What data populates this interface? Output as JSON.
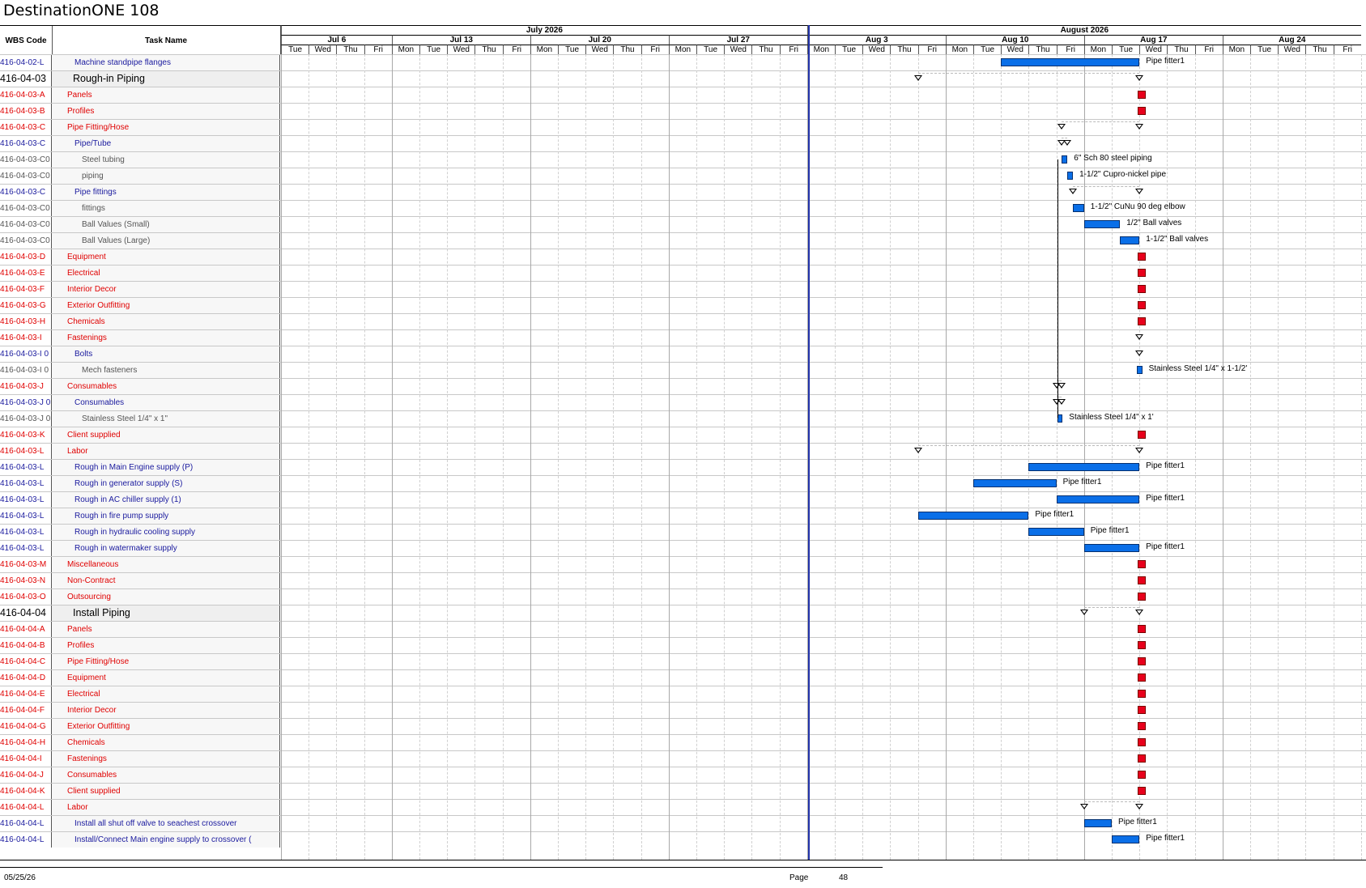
{
  "title": "DestinationONE 108",
  "columns": {
    "wbs": "WBS Code",
    "task": "Task Name"
  },
  "months": [
    "July 2026",
    "August 2026"
  ],
  "weeks": [
    "Jul 6",
    "Jul 13",
    "Jul 20",
    "Jul 27",
    "Aug 3",
    "Aug 10",
    "Aug 17",
    "Aug 24"
  ],
  "days": [
    "Tue",
    "Wed",
    "Thu",
    "Fri",
    "Mon",
    "Tue",
    "Wed",
    "Thu",
    "Fri",
    "Mon",
    "Tue",
    "Wed",
    "Thu",
    "Fri",
    "Mon",
    "Tue",
    "Wed",
    "Thu",
    "Fri",
    "Mon",
    "Tue",
    "Wed",
    "Thu",
    "Fri",
    "Mon",
    "Tue",
    "Wed",
    "Thu",
    "Fri",
    "Mon",
    "Tue",
    "Wed",
    "Thu",
    "Fri",
    "Mon",
    "Tue",
    "Wed",
    "Thu",
    "Fri"
  ],
  "rows": [
    {
      "wbs": "416-04-02-L",
      "task": "Machine standpipe flanges",
      "style": "blue",
      "indent": 2,
      "kind": "bar",
      "start": 26,
      "end": 31,
      "label": "Pipe fitter1"
    },
    {
      "wbs": "416-04-03",
      "task": "Rough-in Piping",
      "style": "big",
      "indent": 1,
      "kind": "summary",
      "start": 23,
      "end": 31
    },
    {
      "wbs": "416-04-03-A",
      "task": "Panels",
      "style": "red",
      "indent": 1,
      "kind": "mile",
      "start": 31
    },
    {
      "wbs": "416-04-03-B",
      "task": "Profiles",
      "style": "red",
      "indent": 1,
      "kind": "mile",
      "start": 31
    },
    {
      "wbs": "416-04-03-C",
      "task": "Pipe Fitting/Hose",
      "style": "red",
      "indent": 1,
      "kind": "summary",
      "start": 28.2,
      "end": 31
    },
    {
      "wbs": "416-04-03-C",
      "task": "Pipe/Tube",
      "style": "blue",
      "indent": 2,
      "kind": "summary",
      "start": 28.2,
      "end": 28.4
    },
    {
      "wbs": "416-04-03-C0",
      "task": "Steel tubing",
      "style": "gray",
      "indent": 3,
      "kind": "bar",
      "start": 28.2,
      "end": 28.4,
      "label": "6\" Sch 80 steel piping"
    },
    {
      "wbs": "416-04-03-C0",
      "task": "piping",
      "style": "gray",
      "indent": 3,
      "kind": "bar",
      "start": 28.4,
      "end": 28.6,
      "label": "1-1/2\" Cupro-nickel pipe"
    },
    {
      "wbs": "416-04-03-C",
      "task": "Pipe fittings",
      "style": "blue",
      "indent": 2,
      "kind": "summary",
      "start": 28.6,
      "end": 31
    },
    {
      "wbs": "416-04-03-C0",
      "task": "fittings",
      "style": "gray",
      "indent": 3,
      "kind": "bar",
      "start": 28.6,
      "end": 29,
      "label": "1-1/2\" CuNu 90 deg elbow"
    },
    {
      "wbs": "416-04-03-C0",
      "task": "Ball Values (Small)",
      "style": "gray",
      "indent": 3,
      "kind": "bar",
      "start": 29,
      "end": 30.3,
      "label": "1/2\" Ball valves"
    },
    {
      "wbs": "416-04-03-C0",
      "task": "Ball Values (Large)",
      "style": "gray",
      "indent": 3,
      "kind": "bar",
      "start": 30.3,
      "end": 31,
      "label": "1-1/2\" Ball valves"
    },
    {
      "wbs": "416-04-03-D",
      "task": "Equipment",
      "style": "red",
      "indent": 1,
      "kind": "mile",
      "start": 31
    },
    {
      "wbs": "416-04-03-E",
      "task": "Electrical",
      "style": "red",
      "indent": 1,
      "kind": "mile",
      "start": 31
    },
    {
      "wbs": "416-04-03-F",
      "task": "Interior Decor",
      "style": "red",
      "indent": 1,
      "kind": "mile",
      "start": 31
    },
    {
      "wbs": "416-04-03-G",
      "task": "Exterior Outfitting",
      "style": "red",
      "indent": 1,
      "kind": "mile",
      "start": 31
    },
    {
      "wbs": "416-04-03-H",
      "task": "Chemicals",
      "style": "red",
      "indent": 1,
      "kind": "mile",
      "start": 31
    },
    {
      "wbs": "416-04-03-I",
      "task": "Fastenings",
      "style": "red",
      "indent": 1,
      "kind": "summary",
      "start": 31,
      "end": 31
    },
    {
      "wbs": "416-04-03-I 0",
      "task": "Bolts",
      "style": "blue",
      "indent": 2,
      "kind": "summary",
      "start": 31,
      "end": 31
    },
    {
      "wbs": "416-04-03-I 0",
      "task": "Mech fasteners",
      "style": "gray",
      "indent": 3,
      "kind": "bar",
      "start": 30.9,
      "end": 31.1,
      "label": "Stainless Steel 1/4\" x 1-1/2'"
    },
    {
      "wbs": "416-04-03-J",
      "task": "Consumables",
      "style": "red",
      "indent": 1,
      "kind": "summary",
      "start": 28,
      "end": 28.2
    },
    {
      "wbs": "416-04-03-J 0",
      "task": "Consumables",
      "style": "blue",
      "indent": 2,
      "kind": "summary",
      "start": 28,
      "end": 28.2
    },
    {
      "wbs": "416-04-03-J 0",
      "task": "Stainless Steel 1/4\" x 1\"",
      "style": "gray",
      "indent": 3,
      "kind": "bar",
      "start": 28.05,
      "end": 28.15,
      "label": "Stainless Steel 1/4\" x 1'"
    },
    {
      "wbs": "416-04-03-K",
      "task": "Client supplied",
      "style": "red",
      "indent": 1,
      "kind": "mile",
      "start": 31
    },
    {
      "wbs": "416-04-03-L",
      "task": "Labor",
      "style": "red",
      "indent": 1,
      "kind": "summary",
      "start": 23,
      "end": 31
    },
    {
      "wbs": "416-04-03-L",
      "task": "Rough in Main Engine supply (P)",
      "style": "blue",
      "indent": 2,
      "kind": "bar",
      "start": 27,
      "end": 31,
      "label": "Pipe fitter1"
    },
    {
      "wbs": "416-04-03-L",
      "task": "Rough in generator supply (S)",
      "style": "blue",
      "indent": 2,
      "kind": "bar",
      "start": 25,
      "end": 28,
      "label": "Pipe fitter1"
    },
    {
      "wbs": "416-04-03-L",
      "task": "Rough in AC chiller supply (1)",
      "style": "blue",
      "indent": 2,
      "kind": "bar",
      "start": 28,
      "end": 31,
      "label": "Pipe fitter1"
    },
    {
      "wbs": "416-04-03-L",
      "task": "Rough in fire pump supply",
      "style": "blue",
      "indent": 2,
      "kind": "bar",
      "start": 23,
      "end": 27,
      "label": "Pipe fitter1"
    },
    {
      "wbs": "416-04-03-L",
      "task": "Rough in hydraulic cooling supply",
      "style": "blue",
      "indent": 2,
      "kind": "bar",
      "start": 27,
      "end": 29,
      "label": "Pipe fitter1"
    },
    {
      "wbs": "416-04-03-L",
      "task": "Rough in watermaker supply",
      "style": "blue",
      "indent": 2,
      "kind": "bar",
      "start": 29,
      "end": 31,
      "label": "Pipe fitter1"
    },
    {
      "wbs": "416-04-03-M",
      "task": "Miscellaneous",
      "style": "red",
      "indent": 1,
      "kind": "mile",
      "start": 31
    },
    {
      "wbs": "416-04-03-N",
      "task": "Non-Contract",
      "style": "red",
      "indent": 1,
      "kind": "mile",
      "start": 31
    },
    {
      "wbs": "416-04-03-O",
      "task": "Outsourcing",
      "style": "red",
      "indent": 1,
      "kind": "mile",
      "start": 31
    },
    {
      "wbs": "416-04-04",
      "task": "Install Piping",
      "style": "big",
      "indent": 1,
      "kind": "summary",
      "start": 29,
      "end": 31
    },
    {
      "wbs": "416-04-04-A",
      "task": "Panels",
      "style": "red",
      "indent": 1,
      "kind": "mile",
      "start": 31
    },
    {
      "wbs": "416-04-04-B",
      "task": "Profiles",
      "style": "red",
      "indent": 1,
      "kind": "mile",
      "start": 31
    },
    {
      "wbs": "416-04-04-C",
      "task": "Pipe Fitting/Hose",
      "style": "red",
      "indent": 1,
      "kind": "mile",
      "start": 31
    },
    {
      "wbs": "416-04-04-D",
      "task": "Equipment",
      "style": "red",
      "indent": 1,
      "kind": "mile",
      "start": 31
    },
    {
      "wbs": "416-04-04-E",
      "task": "Electrical",
      "style": "red",
      "indent": 1,
      "kind": "mile",
      "start": 31
    },
    {
      "wbs": "416-04-04-F",
      "task": "Interior Decor",
      "style": "red",
      "indent": 1,
      "kind": "mile",
      "start": 31
    },
    {
      "wbs": "416-04-04-G",
      "task": "Exterior Outfitting",
      "style": "red",
      "indent": 1,
      "kind": "mile",
      "start": 31
    },
    {
      "wbs": "416-04-04-H",
      "task": "Chemicals",
      "style": "red",
      "indent": 1,
      "kind": "mile",
      "start": 31
    },
    {
      "wbs": "416-04-04-I",
      "task": "Fastenings",
      "style": "red",
      "indent": 1,
      "kind": "mile",
      "start": 31
    },
    {
      "wbs": "416-04-04-J",
      "task": "Consumables",
      "style": "red",
      "indent": 1,
      "kind": "mile",
      "start": 31
    },
    {
      "wbs": "416-04-04-K",
      "task": "Client supplied",
      "style": "red",
      "indent": 1,
      "kind": "mile",
      "start": 31
    },
    {
      "wbs": "416-04-04-L",
      "task": "Labor",
      "style": "red",
      "indent": 1,
      "kind": "summary",
      "start": 29,
      "end": 31
    },
    {
      "wbs": "416-04-04-L",
      "task": "Install all shut off valve to seachest crossover",
      "style": "blue",
      "indent": 2,
      "kind": "bar",
      "start": 29,
      "end": 30,
      "label": "Pipe fitter1"
    },
    {
      "wbs": "416-04-04-L",
      "task": "Install/Connect Main engine supply to crossover (",
      "style": "blue",
      "indent": 2,
      "kind": "bar",
      "start": 30,
      "end": 31,
      "label": "Pipe fitter1"
    }
  ],
  "footer": {
    "date": "05/25/26",
    "page_label": "Page",
    "page_number": "48"
  },
  "colors": {
    "bar": "#0a6fe8",
    "milestone": "#e8001c",
    "red_text": "#e00000",
    "blue_text": "#1a1a9e"
  }
}
